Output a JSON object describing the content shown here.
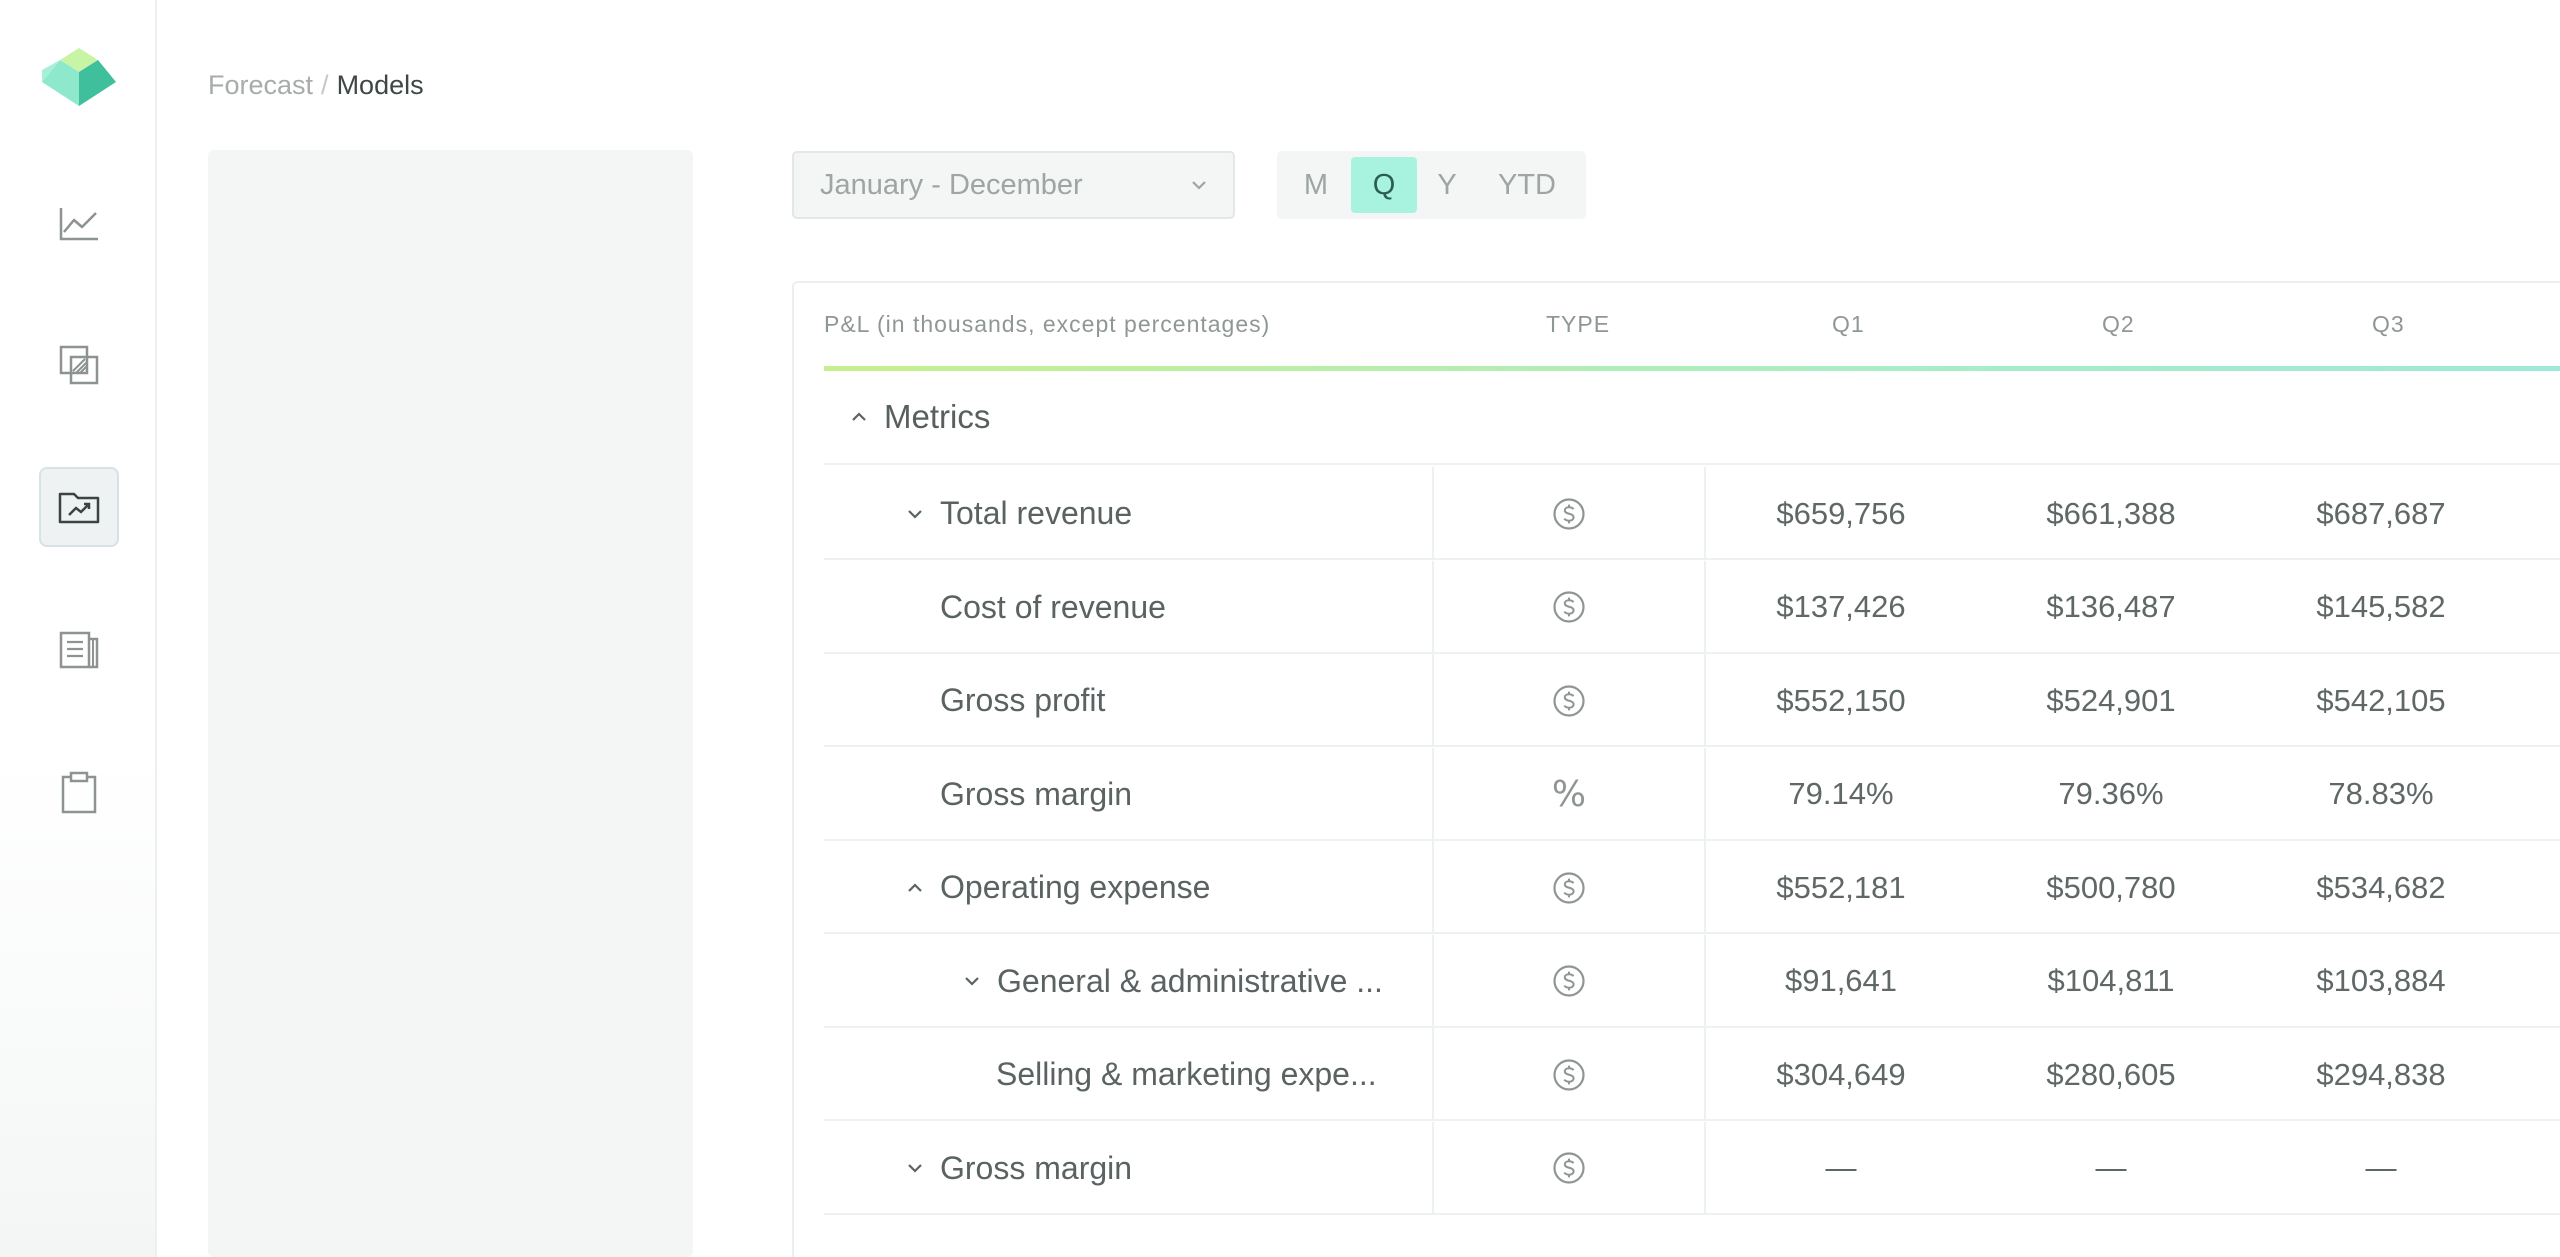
{
  "breadcrumb": {
    "parent": "Forecast",
    "separator": "/",
    "current": "Models"
  },
  "sidebar": {
    "items": [
      {
        "icon": "line-chart-icon",
        "active": false
      },
      {
        "icon": "layers-icon",
        "active": false
      },
      {
        "icon": "folder-chart-icon",
        "active": true
      },
      {
        "icon": "report-icon",
        "active": false
      },
      {
        "icon": "clipboard-icon",
        "active": false
      }
    ]
  },
  "controls": {
    "date_range": "January - December",
    "periods": [
      {
        "label": "M",
        "active": false
      },
      {
        "label": "Q",
        "active": true
      },
      {
        "label": "Y",
        "active": false
      },
      {
        "label": "YTD",
        "active": false
      }
    ]
  },
  "table": {
    "headers": {
      "label": "P&L (in thousands, except percentages)",
      "type": "TYPE",
      "q1": "Q1",
      "q2": "Q2",
      "q3": "Q3"
    },
    "section": "Metrics",
    "rows": [
      {
        "label": "Total revenue",
        "indent": 1,
        "chevron": "down",
        "type": "currency",
        "q1": "$659,756",
        "q2": "$661,388",
        "q3": "$687,687"
      },
      {
        "label": "Cost of revenue",
        "indent": 1,
        "chevron": "none",
        "type": "currency",
        "q1": "$137,426",
        "q2": "$136,487",
        "q3": "$145,582"
      },
      {
        "label": "Gross profit",
        "indent": 1,
        "chevron": "none",
        "type": "currency",
        "q1": "$552,150",
        "q2": "$524,901",
        "q3": "$542,105"
      },
      {
        "label": "Gross margin",
        "indent": 1,
        "chevron": "none",
        "type": "percent",
        "q1": "79.14%",
        "q2": "79.36%",
        "q3": "78.83%"
      },
      {
        "label": "Operating expense",
        "indent": 1,
        "chevron": "up",
        "type": "currency",
        "q1": "$552,181",
        "q2": "$500,780",
        "q3": "$534,682"
      },
      {
        "label": "General & administrative ...",
        "indent": 2,
        "chevron": "down",
        "type": "currency",
        "q1": "$91,641",
        "q2": "$104,811",
        "q3": "$103,884"
      },
      {
        "label": "Selling & marketing expe...",
        "indent": 2,
        "chevron": "none",
        "type": "currency",
        "q1": "$304,649",
        "q2": "$280,605",
        "q3": "$294,838"
      },
      {
        "label": "Gross margin",
        "indent": 1,
        "chevron": "down",
        "type": "currency",
        "q1": "—",
        "q2": "—",
        "q3": "—"
      }
    ]
  },
  "colors": {
    "accent_mint": "#a7f3df",
    "logo_light": "#c8f5a5",
    "logo_mid": "#7fe3c4",
    "logo_dark": "#3fbf9c"
  }
}
